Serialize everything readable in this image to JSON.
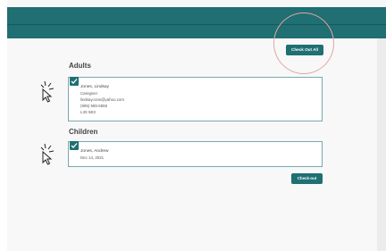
{
  "header": {},
  "actions": {
    "check_out_all_label": "Check Out All",
    "check_out_label": "Check-out"
  },
  "adults": {
    "title": "Adults",
    "person": {
      "name": "Jones, Lindsay",
      "role": "Caregiver",
      "email": "lindsay.rons@yahoo.com",
      "phone": "(905) 555-5555",
      "postal": "L3X 5E3",
      "checked": true
    }
  },
  "children": {
    "title": "Children",
    "person": {
      "name": "Jones, Andrew",
      "dob": "Dec 14, 2021",
      "checked": true
    }
  },
  "colors": {
    "header": "#1f6f73",
    "accent": "#1f6f73",
    "highlight": "#e5a5a5"
  },
  "icons": [
    "checkmark-icon",
    "click-pointer-icon"
  ]
}
